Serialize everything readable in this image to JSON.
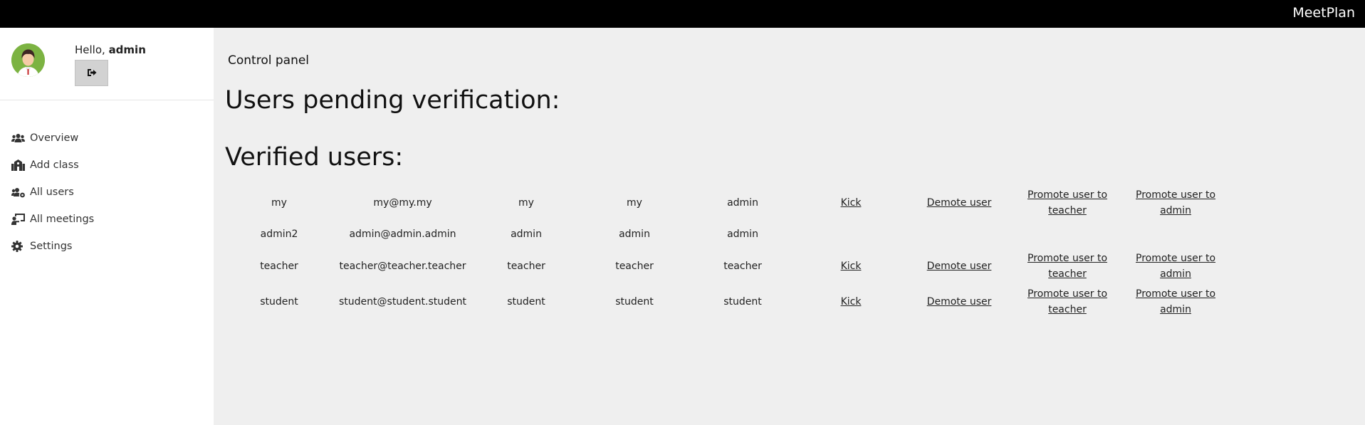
{
  "app": {
    "brand": "MeetPlan"
  },
  "user": {
    "greeting": "Hello, ",
    "name": "admin",
    "logout_icon": "sign-out-icon"
  },
  "sidebar": {
    "items": [
      {
        "label": "Overview",
        "icon": "users-icon"
      },
      {
        "label": "Add class",
        "icon": "school-icon"
      },
      {
        "label": "All users",
        "icon": "users-cog-icon"
      },
      {
        "label": "All meetings",
        "icon": "chalkboard-teacher-icon"
      },
      {
        "label": "Settings",
        "icon": "gear-icon"
      }
    ]
  },
  "main": {
    "panel_title": "Control panel",
    "pending_heading": "Users pending verification:",
    "verified_heading": "Verified users:"
  },
  "actions": {
    "kick": "Kick",
    "demote": "Demote user",
    "promote_teacher": "Promote user to teacher",
    "promote_admin": "Promote user to admin"
  },
  "verified_users": [
    {
      "username": "my",
      "email": "my@my.my",
      "name": "my",
      "surname": "my",
      "role": "admin"
    },
    {
      "username": "admin2",
      "email": "admin@admin.admin",
      "name": "admin",
      "surname": "admin",
      "role": "admin"
    },
    {
      "username": "teacher",
      "email": "teacher@teacher.teacher",
      "name": "teacher",
      "surname": "teacher",
      "role": "teacher"
    },
    {
      "username": "student",
      "email": "student@student.student",
      "name": "student",
      "surname": "student",
      "role": "student"
    }
  ]
}
